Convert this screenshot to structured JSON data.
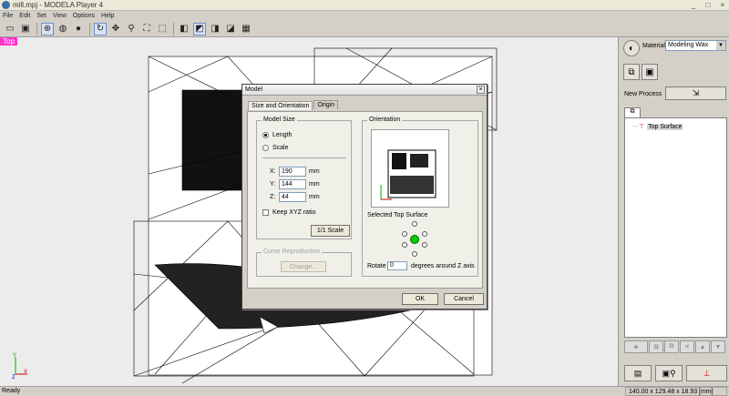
{
  "window": {
    "title": "mill.mpj - MODELA Player 4",
    "min": "_",
    "max": "□",
    "close": "×"
  },
  "menu": [
    "File",
    "Edit",
    "Set",
    "View",
    "Options",
    "Help"
  ],
  "toolbar": [
    "open-icon",
    "save-icon",
    "view-iso-icon",
    "view-globe-icon",
    "view-sphere-icon",
    "rotate-icon",
    "pan-icon",
    "zoom-icon",
    "fit-icon",
    "zoom-window-icon",
    "view-front-icon",
    "view-top-icon",
    "view-right-icon",
    "view-back-icon",
    "view-grid-icon"
  ],
  "viewport": {
    "label": "Top",
    "axis_y": "Y",
    "axis_x": "X",
    "axis_z": "Z"
  },
  "side": {
    "material_label": "Material",
    "material_value": "Modeling Wax",
    "new_process_label": "New Process",
    "tree_item": "Top Surface"
  },
  "status": {
    "left": "Ready",
    "dims": "140.00 x 129.48 x 18.93 [mm]"
  },
  "dialog": {
    "title": "Model",
    "close": "×",
    "tabs": [
      "Size and Orientation",
      "Origin"
    ],
    "model_size": {
      "label": "Model Size",
      "length": "Length",
      "scale": "Scale",
      "x_label": "X:",
      "x_value": "190",
      "y_label": "Y:",
      "y_value": "144",
      "z_label": "Z:",
      "z_value": "44",
      "unit": "mm",
      "keep_ratio": "Keep XYZ ratio",
      "one_to_one": "1/1 Scale"
    },
    "curve": {
      "label": "Curve Reproduction",
      "change": "Change..."
    },
    "orientation": {
      "label": "Orientation",
      "selected_surface": "Selected Top Surface",
      "rotate": "Rotate",
      "rotate_value": "0",
      "rotate_suffix": "degrees around Z axis"
    },
    "ok": "OK",
    "cancel": "Cancel"
  },
  "colors": {
    "view_label": "#ff33cc",
    "background": "#d4d0c8"
  }
}
